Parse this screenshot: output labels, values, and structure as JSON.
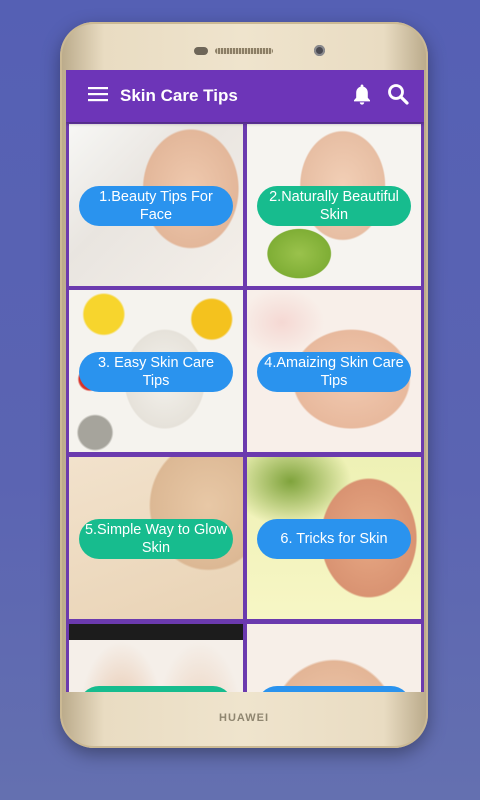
{
  "device": {
    "brand": "HUAWEI"
  },
  "appbar": {
    "title": "Skin Care Tips",
    "menu_icon": "hamburger-icon",
    "actions": [
      {
        "icon": "bell-icon"
      },
      {
        "icon": "search-icon"
      }
    ],
    "color": "#6d35b8"
  },
  "tiles": [
    {
      "label": "1.Beauty Tips For Face",
      "pill_color": "#2a93ee"
    },
    {
      "label": "2.Naturally Beautiful Skin",
      "pill_color": "#17bc8e"
    },
    {
      "label": "3. Easy Skin Care Tips",
      "pill_color": "#2a93ee"
    },
    {
      "label": "4.Amaizing Skin Care Tips",
      "pill_color": "#2a93ee"
    },
    {
      "label": "5.Simple Way to Glow Skin",
      "pill_color": "#17bc8e"
    },
    {
      "label": "6. Tricks for Skin",
      "pill_color": "#2a93ee"
    }
  ],
  "colors": {
    "background": "#5a63b2",
    "grid_gap": "#6b3aae",
    "pill_blue": "#2a93ee",
    "pill_green": "#17bc8e"
  }
}
